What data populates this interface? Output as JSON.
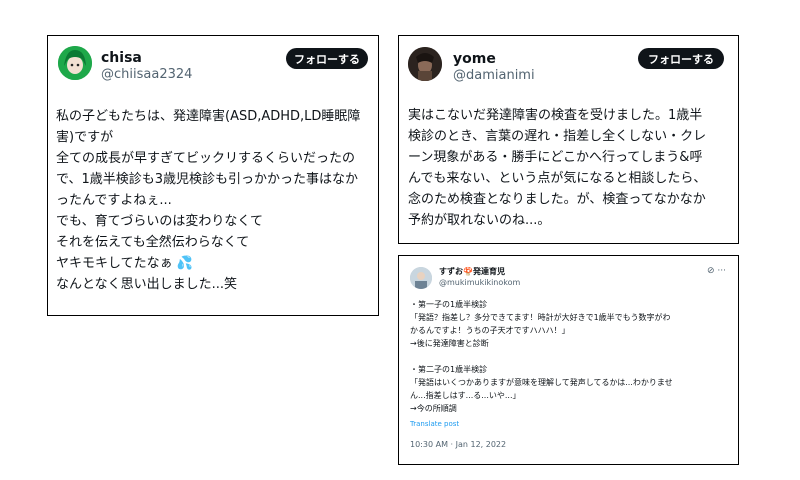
{
  "cards": [
    {
      "author": "chisa",
      "handle": "@chiisaa2324",
      "follow_label": "フォローする",
      "text": "私の子どもたちは、発達障害(ASD,ADHD,LD睡眠障\n害)ですが\n全ての成長が早すぎてビックリするくらいだったの\nで、1歳半検診も3歳児検診も引っかかった事はなか\nったんですよねぇ...\nでも、育てづらいのは変わりなくて\nそれを伝えても全然伝わらなくて\nヤキモキしてたなぁ 💦\nなんとなく思い出しました...笑",
      "avatar_icon": "avatar-green-hair-icon"
    },
    {
      "author": "yome",
      "handle": "@damianimi",
      "follow_label": "フォローする",
      "text": "実はこないだ発達障害の検査を受けました。1歳半\n検診のとき、言葉の遅れ・指差し全くしない・クレ\nーン現象がある・勝手にどこかへ行ってしまう&呼\nんでも来ない、という点が気になると相談したら、\n念のため検査となりました。が、検査ってなかなか\n予約が取れないのね...。",
      "avatar_icon": "avatar-dark-photo-icon"
    },
    {
      "author": "すずお🍄発達育児",
      "handle": "@mukimukikinokom",
      "tools": "⊘ ···",
      "text": "・第一子の1歳半検診\n「発語？指差し？多分できてます！時計が大好きで1歳半でもう数字がわ\nかるんですよ！うちの子天才ですハハハ！」\n→後に発達障害と診断\n\n・第二子の1歳半検診\n「発語はいくつかありますが意味を理解して発声してるかは...わかりませ\nん...指差しはす...る...いや...」\n→今の所順調",
      "translate_label": "Translate post",
      "timestamp": "10:30 AM · Jan 12, 2022",
      "avatar_icon": "avatar-photo-icon"
    }
  ]
}
